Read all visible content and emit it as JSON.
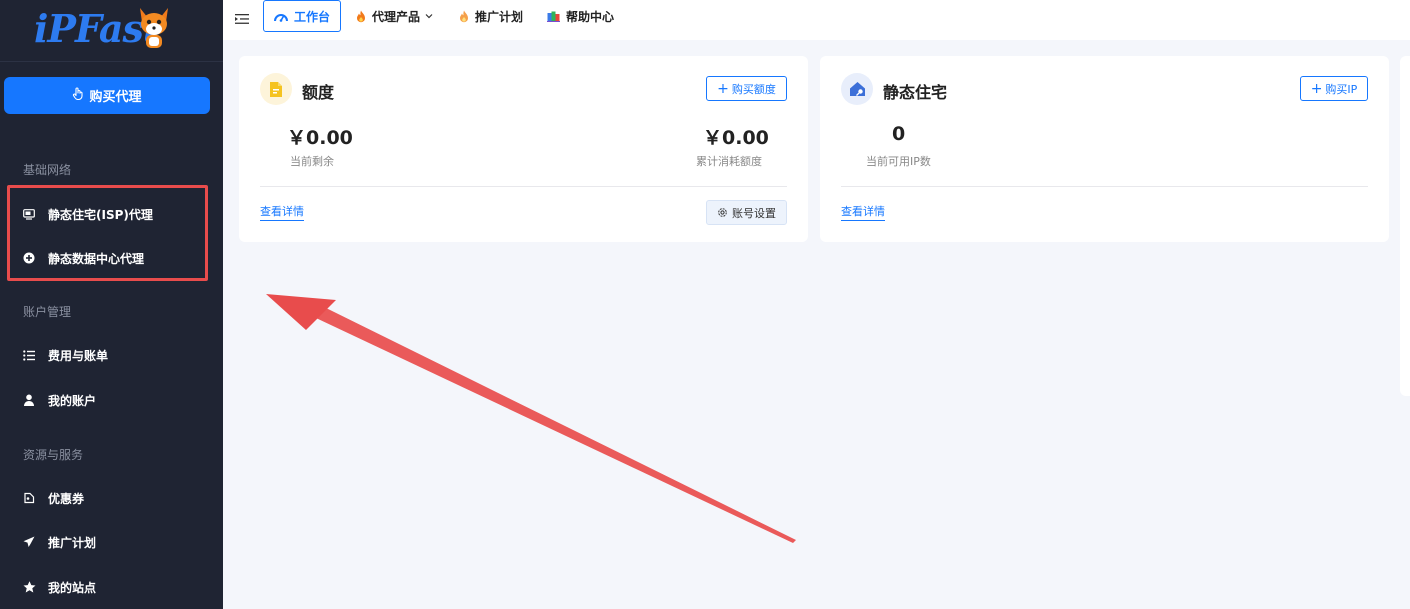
{
  "brand": {
    "logo_text": "iPFast"
  },
  "sidebar": {
    "buy_button": "购买代理",
    "sections": [
      {
        "title": "基础网络",
        "items": [
          {
            "label": "静态住宅(ISP)代理",
            "icon": "monitor-icon"
          },
          {
            "label": "静态数据中心代理",
            "icon": "plus-circle-icon"
          }
        ]
      },
      {
        "title": "账户管理",
        "items": [
          {
            "label": "费用与账单",
            "icon": "list-icon"
          },
          {
            "label": "我的账户",
            "icon": "user-icon"
          }
        ]
      },
      {
        "title": "资源与服务",
        "items": [
          {
            "label": "优惠券",
            "icon": "coupon-icon"
          },
          {
            "label": "推广计划",
            "icon": "paper-plane-icon"
          },
          {
            "label": "我的站点",
            "icon": "star-icon"
          }
        ]
      }
    ]
  },
  "topbar": {
    "tabs": [
      {
        "label": "工作台",
        "icon": "dashboard-icon",
        "active": true
      },
      {
        "label": "代理产品",
        "icon": "fire-icon",
        "has_dropdown": true
      },
      {
        "label": "推广计划",
        "icon": "flame-icon"
      },
      {
        "label": "帮助中心",
        "icon": "books-icon"
      }
    ]
  },
  "cards": {
    "quota": {
      "title": "额度",
      "buy_button": "购买额度",
      "balance_value": "￥0.00",
      "balance_label": "当前剩余",
      "consumed_value": "￥0.00",
      "consumed_label": "累计消耗额度",
      "details_link": "查看详情",
      "settings_button": "账号设置"
    },
    "static_residential": {
      "title": "静态住宅",
      "buy_button": "购买IP",
      "ip_count_value": "0",
      "ip_count_label": "当前可用IP数",
      "details_link": "查看详情"
    }
  },
  "colors": {
    "accent": "#1677ff",
    "sidebar_bg": "#1f2433",
    "annotation": "#e84c4c"
  }
}
